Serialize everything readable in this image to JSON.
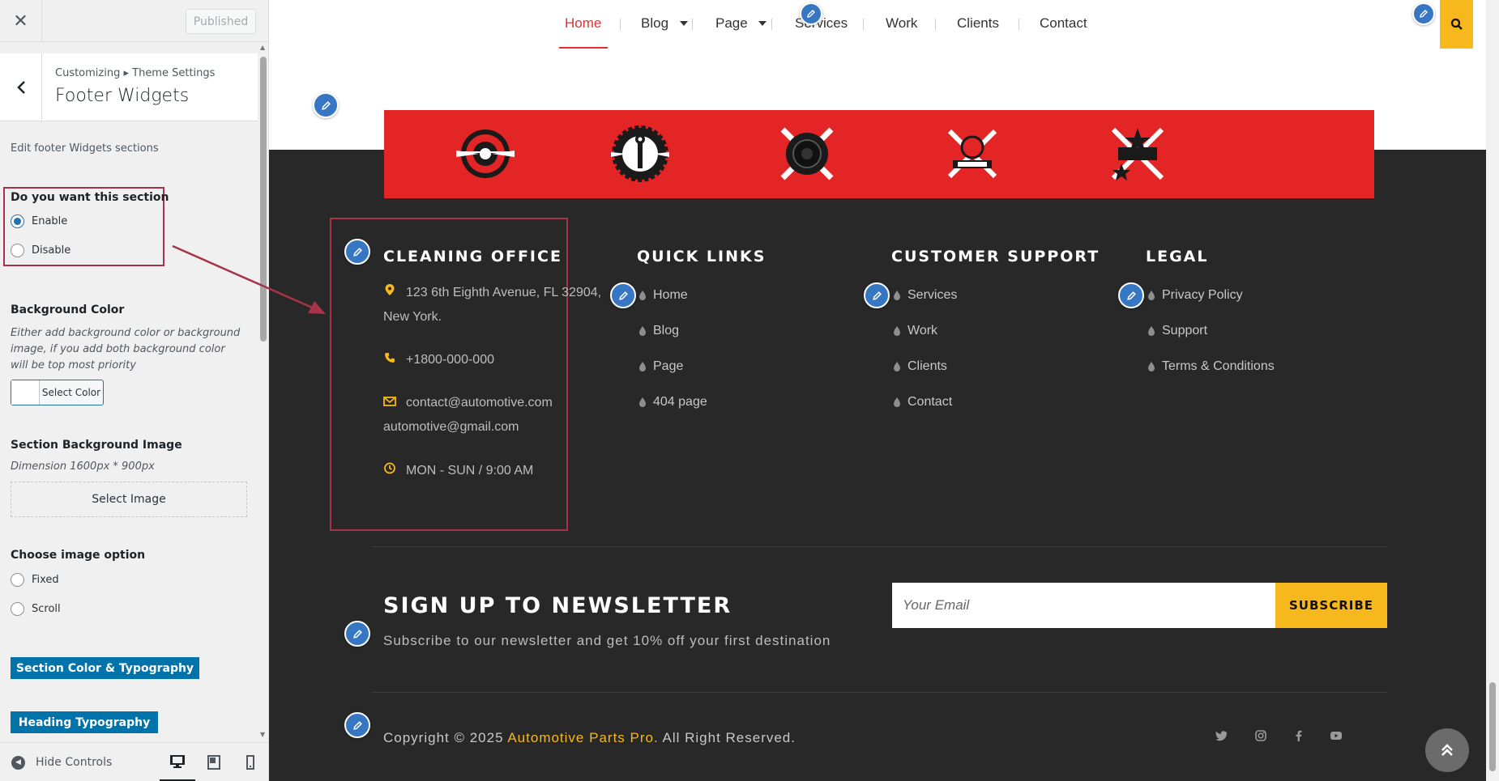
{
  "sidebar": {
    "close_glyph": "✕",
    "published_label": "Published",
    "breadcrumb": "Customizing ▸ Theme Settings",
    "panel_title": "Footer Widgets",
    "description": "Edit footer Widgets sections",
    "section_toggle": {
      "title": "Do you want this section",
      "options": [
        "Enable",
        "Disable"
      ],
      "selected": "Enable"
    },
    "background_color": {
      "title": "Background Color",
      "description": "Either add background color or background image, if you add both background color will be top most priority",
      "button_label": "Select Color"
    },
    "background_image": {
      "title": "Section Background Image",
      "dimension": "Dimension 1600px * 900px",
      "button_label": "Select Image"
    },
    "image_option": {
      "title": "Choose image option",
      "options": [
        "Fixed",
        "Scroll"
      ]
    },
    "buttons": [
      "Section Color & Typography",
      "Heading Typography"
    ],
    "footer": {
      "hide_controls": "Hide Controls",
      "devices": [
        "desktop-icon",
        "tablet-icon",
        "mobile-icon"
      ],
      "active_device": "desktop"
    }
  },
  "preview": {
    "nav": {
      "items": [
        "Home",
        "Blog",
        "Page",
        "Services",
        "Work",
        "Clients",
        "Contact"
      ],
      "active": "Home"
    },
    "logos": [
      "auto-service-wings-logo",
      "gear-wrench-1992-logo",
      "tire-auto-service-logo",
      "crossed-wrenches-1992-logo",
      "stars-1992-logo"
    ],
    "office": {
      "title": "CLEANING OFFICE",
      "address_line1": "123 6th Eighth Avenue, FL 32904,",
      "address_line2": "New York.",
      "phone": "+1800-000-000",
      "email1": "contact@automotive.com",
      "email2": "automotive@gmail.com",
      "hours": "MON - SUN / 9:00 AM"
    },
    "quick_links": {
      "title": "QUICK LINKS",
      "items": [
        "Home",
        "Blog",
        "Page",
        "404 page"
      ]
    },
    "customer_support": {
      "title": "CUSTOMER SUPPORT",
      "items": [
        "Services",
        "Work",
        "Clients",
        "Contact"
      ]
    },
    "legal": {
      "title": "LEGAL",
      "items": [
        "Privacy Policy",
        "Support",
        "Terms & Conditions"
      ]
    },
    "newsletter": {
      "title": "SIGN UP TO NEWSLETTER",
      "subtitle": "Subscribe to our newsletter and get 10% off your first destination",
      "placeholder": "Your Email",
      "button": "SUBSCRIBE"
    },
    "copyright": {
      "prefix": "Copyright © 2025",
      "brand": "Automotive Parts Pro.",
      "suffix": "All Right Reserved."
    },
    "social": [
      "twitter-icon",
      "instagram-icon",
      "facebook-icon",
      "youtube-icon"
    ]
  },
  "colors": {
    "accent_red": "#e52e2e",
    "accent_yellow": "#f6b81c",
    "footer_bg": "#282828",
    "wp_blue": "#0073aa",
    "highlight": "#a6334a"
  }
}
